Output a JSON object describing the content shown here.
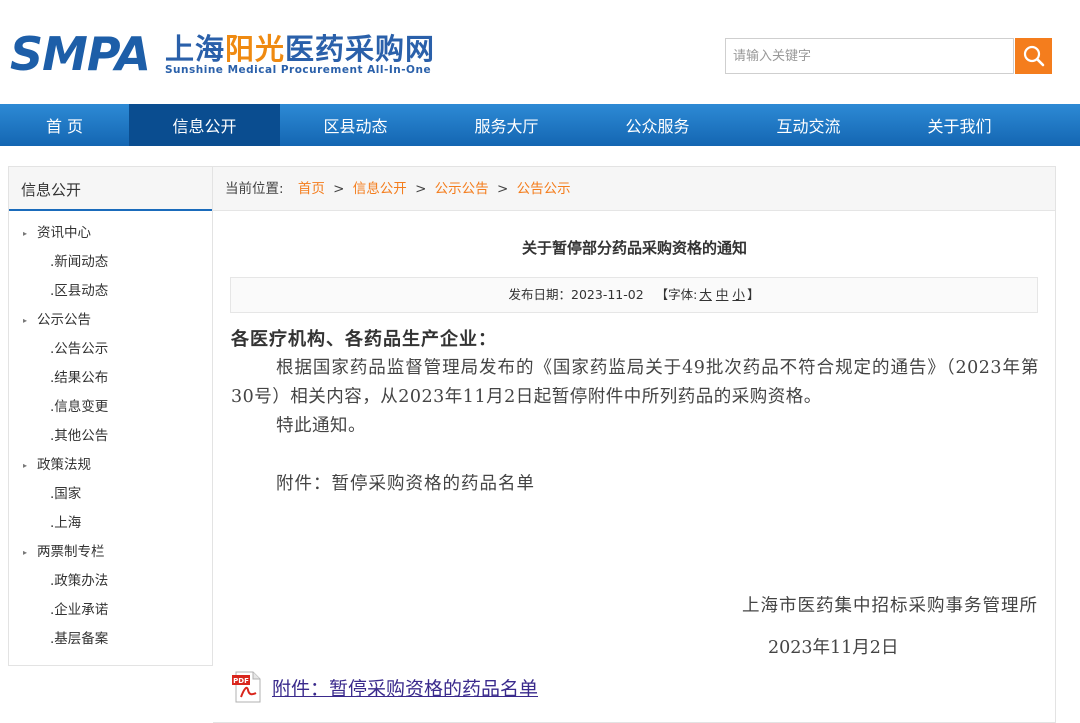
{
  "header": {
    "logo_abbr": "SMPA",
    "logo_cn_part1": "上海",
    "logo_cn_part2": "阳光",
    "logo_cn_part3": "医药",
    "logo_cn_part4": "采购网",
    "logo_en": "Sunshine Medical Procurement All-In-One",
    "search_placeholder": "请输入关键字"
  },
  "nav": {
    "items": [
      "首 页",
      "信息公开",
      "区县动态",
      "服务大厅",
      "公众服务",
      "互动交流",
      "关于我们"
    ],
    "active": "信息公开"
  },
  "sidebar": {
    "title": "信息公开",
    "groups": [
      {
        "label": "资讯中心",
        "items": [
          ".新闻动态",
          ".区县动态"
        ]
      },
      {
        "label": "公示公告",
        "items": [
          ".公告公示",
          ".结果公布",
          ".信息变更",
          ".其他公告"
        ]
      },
      {
        "label": "政策法规",
        "items": [
          ".国家",
          ".上海"
        ]
      },
      {
        "label": "两票制专栏",
        "items": [
          ".政策办法",
          ".企业承诺",
          ".基层备案"
        ]
      }
    ]
  },
  "breadcrumb": {
    "prefix": "当前位置:",
    "items": [
      "首页",
      "信息公开",
      "公示公告",
      "公告公示"
    ],
    "separator": ">"
  },
  "article": {
    "title": "关于暂停部分药品采购资格的通知",
    "date_label": "发布日期：2023-11-02",
    "font_label_open": "【字体:",
    "font_large": "大",
    "font_medium": "中",
    "font_small": "小",
    "font_label_close": "】",
    "salutation": "各医疗机构、各药品生产企业：",
    "paragraph1": "根据国家药品监督管理局发布的《国家药监局关于49批次药品不符合规定的通告》（2023年第30号）相关内容，从2023年11月2日起暂停附件中所列药品的采购资格。",
    "paragraph2": "特此通知。",
    "attachment_line": "附件：暂停采购资格的药品名单",
    "signature": "上海市医药集中招标采购事务管理所",
    "sign_date": "2023年11月2日",
    "attachment_link": "附件：暂停采购资格的药品名单"
  },
  "colors": {
    "brand_blue": "#1d5ea8",
    "brand_orange": "#ef8a11",
    "nav_blue": "#1466b2",
    "nav_active": "#0a4d90",
    "link_orange": "#f47d1d",
    "attach_link": "#3a2a8c"
  }
}
